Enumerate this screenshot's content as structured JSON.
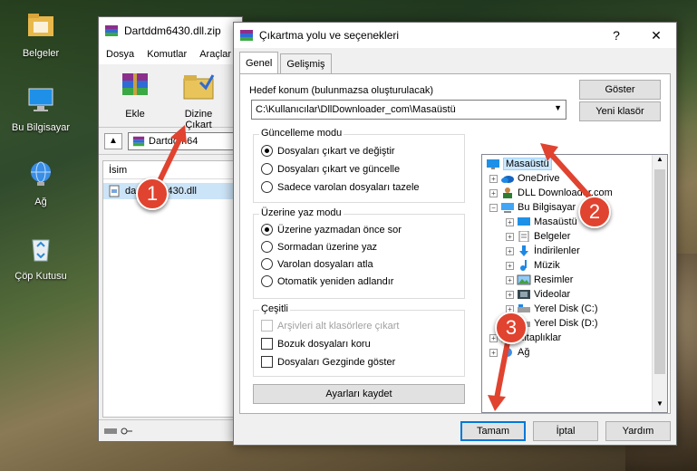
{
  "desktop": {
    "icons": [
      {
        "label": "Belgeler"
      },
      {
        "label": "Bu Bilgisayar"
      },
      {
        "label": "Ağ"
      },
      {
        "label": "Çöp Kutusu"
      }
    ]
  },
  "rar": {
    "title": "Dartddm6430.dll.zip",
    "menu": [
      "Dosya",
      "Komutlar",
      "Araçlar"
    ],
    "tools": [
      {
        "label": "Ekle"
      },
      {
        "label": "Dizine Çıkart"
      }
    ],
    "path_text": "Dartddm64",
    "list_header": "İsim",
    "file_name": "dartddm6430.dll"
  },
  "dialog": {
    "title": "Çıkartma yolu ve seçenekleri",
    "help_btn": "?",
    "close_btn": "✕",
    "tabs": [
      "Genel",
      "Gelişmiş"
    ],
    "target_label": "Hedef konum (bulunmazsa oluşturulacak)",
    "target_value": "C:\\Kullanıcılar\\DllDownloader_com\\Masaüstü",
    "show_btn": "Göster",
    "new_folder_btn": "Yeni klasör",
    "update_group": {
      "title": "Güncelleme modu",
      "options": [
        "Dosyaları çıkart ve değiştir",
        "Dosyaları çıkart ve güncelle",
        "Sadece varolan dosyaları tazele"
      ]
    },
    "overwrite_group": {
      "title": "Üzerine yaz modu",
      "options": [
        "Üzerine yazmadan önce sor",
        "Sormadan üzerine yaz",
        "Varolan dosyaları atla",
        "Otomatik yeniden adlandır"
      ]
    },
    "misc_group": {
      "title": "Çeşitli",
      "options": [
        "Arşivleri alt klasörlere çıkart",
        "Bozuk dosyaları koru",
        "Dosyaları Gezginde göster"
      ]
    },
    "save_settings_btn": "Ayarları kaydet",
    "tree": [
      {
        "label": "Masaüstü"
      },
      {
        "label": "OneDrive"
      },
      {
        "label": "DLL Downloader.com"
      },
      {
        "label": "Bu Bilgisayar"
      },
      {
        "label": "Masaüstü"
      },
      {
        "label": "Belgeler"
      },
      {
        "label": "İndirilenler"
      },
      {
        "label": "Müzik"
      },
      {
        "label": "Resimler"
      },
      {
        "label": "Videolar"
      },
      {
        "label": "Yerel Disk (C:)"
      },
      {
        "label": "Yerel Disk (D:)"
      },
      {
        "label": "Kitaplıklar"
      },
      {
        "label": "Ağ"
      }
    ],
    "ok_btn": "Tamam",
    "cancel_btn": "İptal",
    "help_text_btn": "Yardım"
  },
  "annotations": {
    "badges": [
      "1",
      "2",
      "3"
    ],
    "color": "#e0432f"
  }
}
